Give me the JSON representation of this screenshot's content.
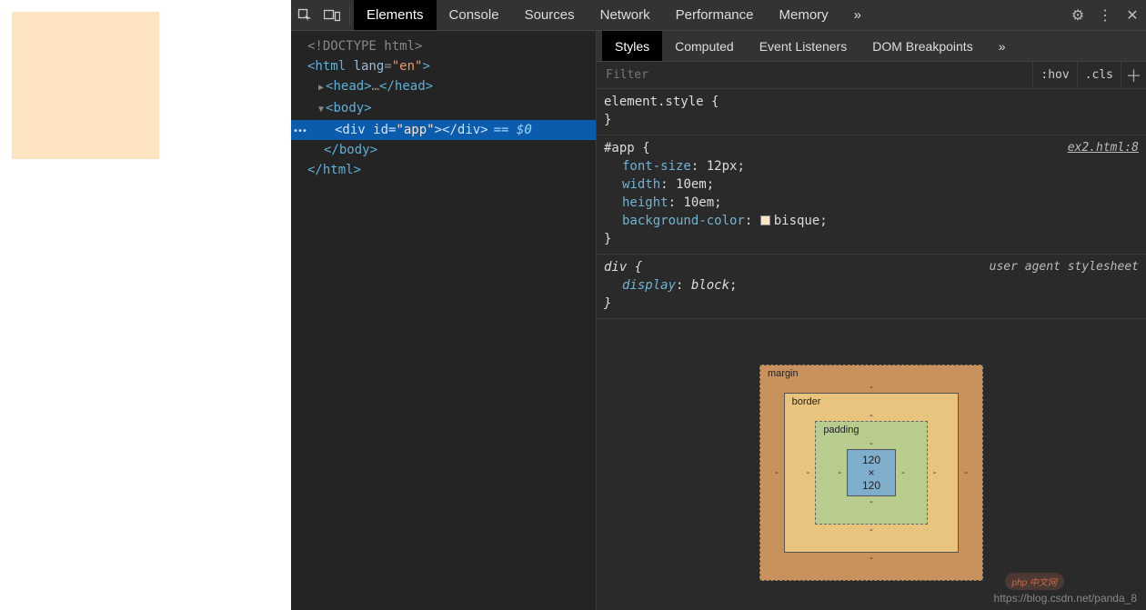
{
  "page": {
    "app_bg": "#ffe4c4"
  },
  "toolbar": {
    "tabs": [
      "Elements",
      "Console",
      "Sources",
      "Network",
      "Performance",
      "Memory"
    ],
    "more": "»"
  },
  "dom": {
    "doctype": "<!DOCTYPE html>",
    "html_open": "<html lang=\"en\">",
    "head": "<head>…</head>",
    "body_open": "<body>",
    "app_line_prefix": "<div id=",
    "app_id": "\"app\"",
    "app_line_suffix": "></div>",
    "eq": "== $0",
    "body_close": "</body>",
    "html_close": "</html>"
  },
  "styles_tabs": [
    "Styles",
    "Computed",
    "Event Listeners",
    "DOM Breakpoints"
  ],
  "styles_more": "»",
  "filter": {
    "placeholder": "Filter",
    "hov": ":hov",
    "cls": ".cls"
  },
  "rules": {
    "element_style_sel": "element.style {",
    "close": "}",
    "app_sel": "#app {",
    "app_origin": "ex2.html:8",
    "props": {
      "font_size": {
        "n": "font-size",
        "v": "12px"
      },
      "width": {
        "n": "width",
        "v": "10em"
      },
      "height": {
        "n": "height",
        "v": "10em"
      },
      "bg": {
        "n": "background-color",
        "v": "bisque"
      }
    },
    "div_sel": "div {",
    "ua_origin": "user agent stylesheet",
    "display": {
      "n": "display",
      "v": "block"
    }
  },
  "box": {
    "margin": "margin",
    "border": "border",
    "padding": "padding",
    "content": "120 × 120",
    "dash": "-"
  },
  "watermark": "https://blog.csdn.net/panda_8",
  "php_badge": "php 中文网"
}
